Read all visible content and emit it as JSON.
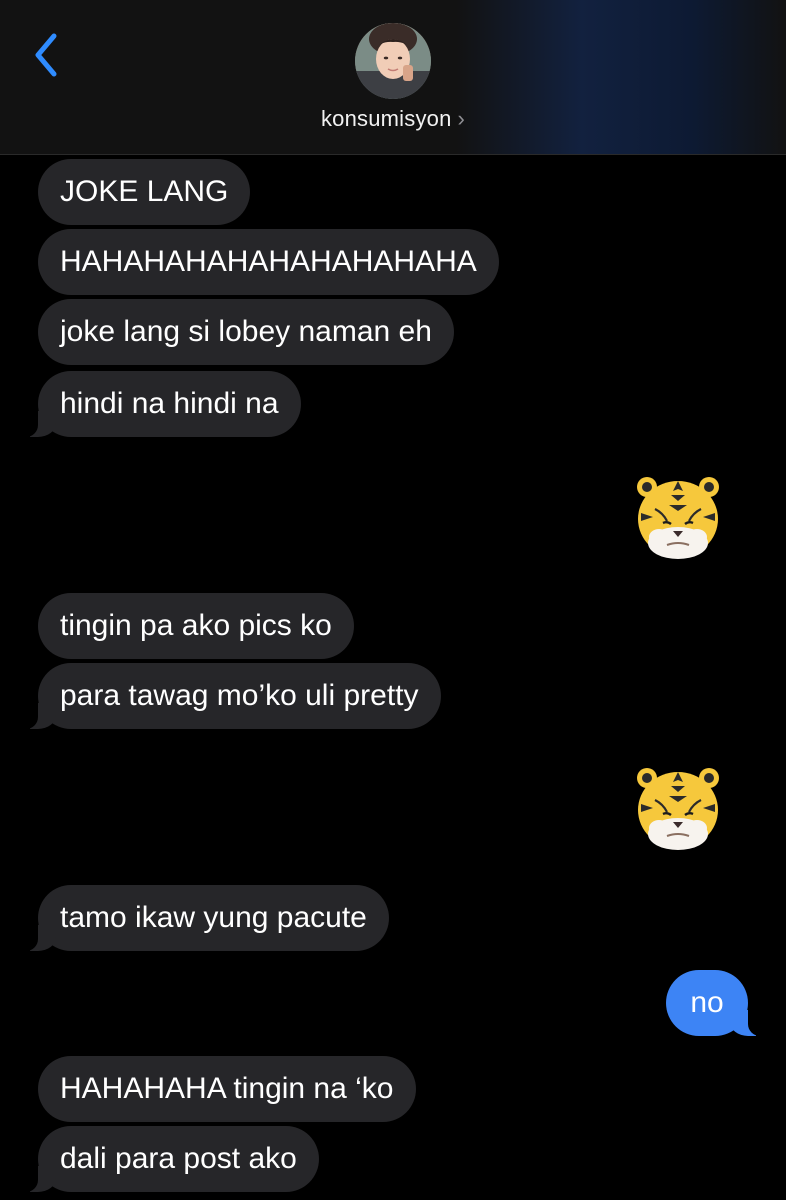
{
  "header": {
    "contact_name": "konsumisyon",
    "chevron": "›",
    "back_icon": "chevron-left-icon",
    "accent_color": "#3d84f5"
  },
  "messages": [
    {
      "side": "received",
      "text": "JOKE LANG"
    },
    {
      "side": "received",
      "text": "HAHAHAHAHAHAHAHAHAHA"
    },
    {
      "side": "received",
      "text": "joke lang si lobey naman eh"
    },
    {
      "side": "received",
      "text": "hindi na hindi na"
    },
    {
      "side": "sent",
      "sticker": "tiger-memoji-icon"
    },
    {
      "side": "received",
      "text": "tingin pa ako pics ko"
    },
    {
      "side": "received",
      "text": "para tawag mo’ko uli pretty"
    },
    {
      "side": "sent",
      "sticker": "tiger-memoji-icon"
    },
    {
      "side": "received",
      "text": "tamo ikaw yung pacute"
    },
    {
      "side": "sent",
      "text": "no"
    },
    {
      "side": "received",
      "text": "HAHAHAHA tingin na ‘ko"
    },
    {
      "side": "received",
      "text": "dali para post ako"
    }
  ],
  "colors": {
    "received_bubble": "#262629",
    "sent_bubble": "#3d84f5",
    "background": "#000000"
  }
}
